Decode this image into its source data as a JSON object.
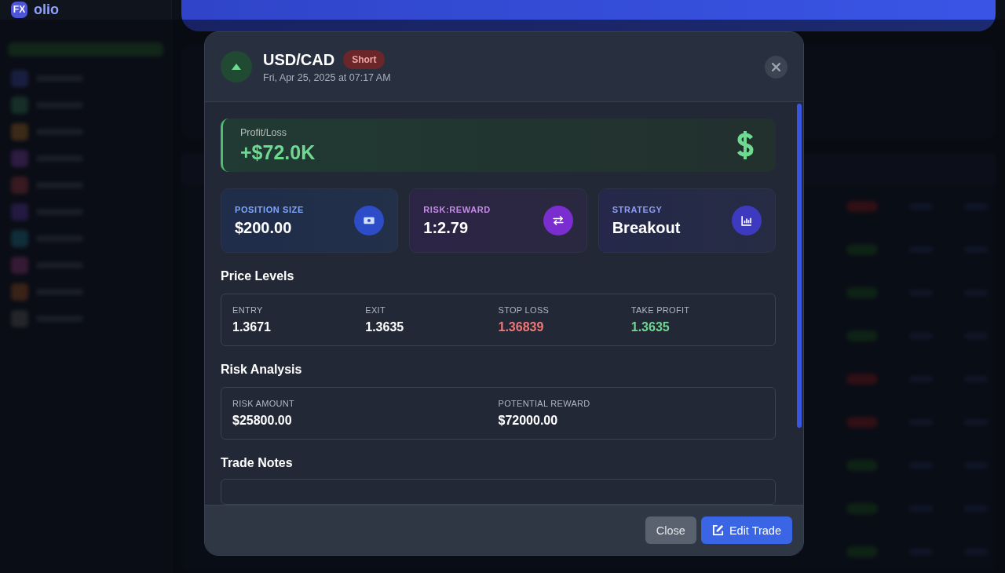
{
  "app": {
    "logo_mark": "FX",
    "logo_text": "olio"
  },
  "modal": {
    "pair": "USD/CAD",
    "side": "Short",
    "timestamp": "Fri, Apr 25, 2025 at 07:17 AM",
    "pnl": {
      "label": "Profit/Loss",
      "value": "+$72.0K"
    },
    "stats": [
      {
        "kind": "size",
        "label": "POSITION SIZE",
        "value": "$200.00"
      },
      {
        "kind": "ratio",
        "label": "RISK:REWARD",
        "value": "1:2.79"
      },
      {
        "kind": "strategy",
        "label": "STRATEGY",
        "value": "Breakout"
      }
    ],
    "price_levels": {
      "title": "Price Levels",
      "items": [
        {
          "label": "ENTRY",
          "value": "1.3671",
          "color": "#ffffff"
        },
        {
          "label": "EXIT",
          "value": "1.3635",
          "color": "#ffffff"
        },
        {
          "label": "STOP LOSS",
          "value": "1.36839",
          "color": "#f07878"
        },
        {
          "label": "TAKE PROFIT",
          "value": "1.3635",
          "color": "#6fd891"
        }
      ]
    },
    "risk_analysis": {
      "title": "Risk Analysis",
      "items": [
        {
          "label": "RISK AMOUNT",
          "value": "$25800.00"
        },
        {
          "label": "POTENTIAL REWARD",
          "value": "$72000.00"
        }
      ]
    },
    "notes": {
      "title": "Trade Notes"
    },
    "buttons": [
      {
        "kind": "secondary",
        "label": "Close"
      },
      {
        "kind": "primary",
        "label": "Edit Trade"
      }
    ]
  }
}
